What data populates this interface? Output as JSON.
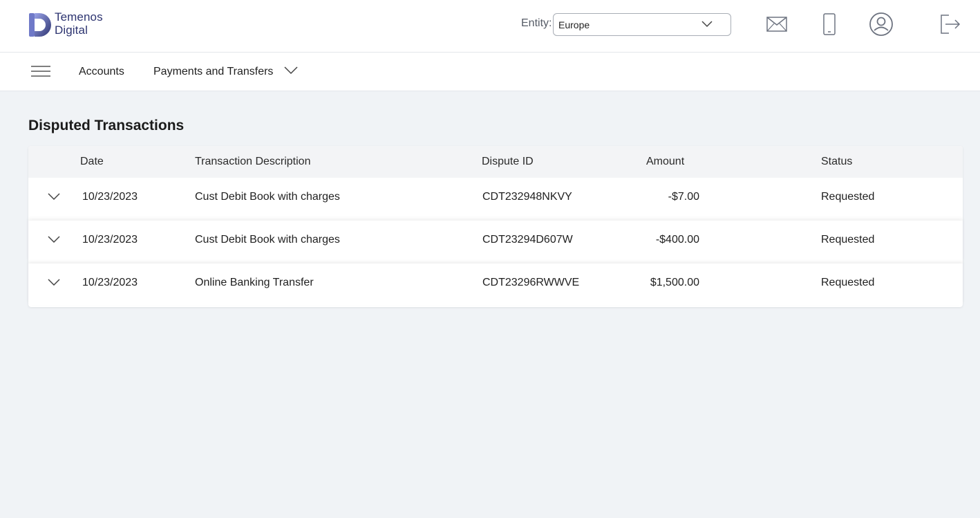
{
  "brand": {
    "line1": "Temenos",
    "line2": "Digital"
  },
  "header": {
    "entity_label": "Entity:",
    "entity_value": "Europe",
    "icons": [
      "mail-icon",
      "mobile-icon",
      "profile-icon",
      "logout-icon"
    ]
  },
  "nav": {
    "items": [
      {
        "label": "Accounts"
      },
      {
        "label": "Payments and Transfers"
      }
    ]
  },
  "page": {
    "title": "Disputed Transactions"
  },
  "table": {
    "columns": [
      "Date",
      "Transaction Description",
      "Dispute ID",
      "Amount",
      "Status"
    ],
    "rows": [
      {
        "date": "10/23/2023",
        "description": "Cust Debit Book with charges",
        "dispute_id": "CDT232948NKVY",
        "amount": "-$7.00",
        "status": "Requested"
      },
      {
        "date": "10/23/2023",
        "description": "Cust Debit Book with charges",
        "dispute_id": "CDT23294D607W",
        "amount": "-$400.00",
        "status": "Requested"
      },
      {
        "date": "10/23/2023",
        "description": "Online Banking Transfer",
        "dispute_id": "CDT23296RWWVE",
        "amount": "$1,500.00",
        "status": "Requested"
      }
    ]
  },
  "colors": {
    "brand": "#2d3470",
    "background": "#f0f3f6",
    "header_row": "#f3f4f6"
  }
}
